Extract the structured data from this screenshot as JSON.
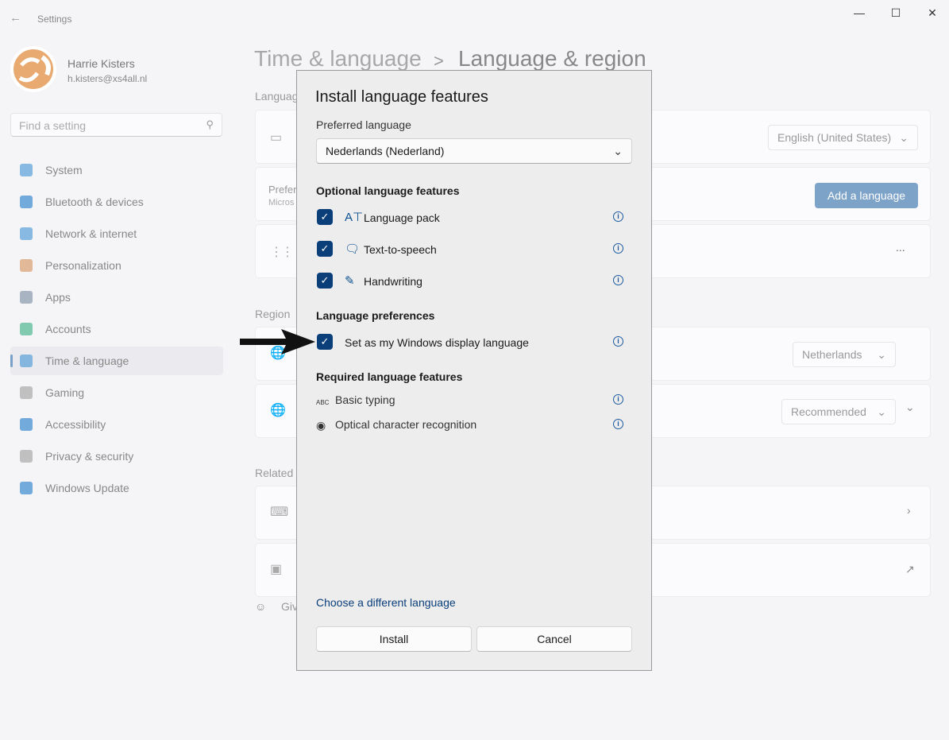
{
  "window": {
    "title": "Settings",
    "icons": [
      "back-arrow-icon",
      "minimize-icon",
      "maximize-icon",
      "close-icon"
    ]
  },
  "user": {
    "name": "Harrie Kisters",
    "email": "h.kisters@xs4all.nl"
  },
  "search": {
    "placeholder": "Find a setting"
  },
  "sidebar": {
    "items": [
      {
        "label": "System",
        "color": "#5aa0d8"
      },
      {
        "label": "Bluetooth & devices",
        "color": "#3a8ad0"
      },
      {
        "label": "Network & internet",
        "color": "#5aa0d8"
      },
      {
        "label": "Personalization",
        "color": "#d8a070"
      },
      {
        "label": "Apps",
        "color": "#8899aa"
      },
      {
        "label": "Accounts",
        "color": "#50b890"
      },
      {
        "label": "Time & language",
        "color": "#5aa0d8",
        "selected": true
      },
      {
        "label": "Gaming",
        "color": "#aaa"
      },
      {
        "label": "Accessibility",
        "color": "#3a8ad0"
      },
      {
        "label": "Privacy & security",
        "color": "#aaa"
      },
      {
        "label": "Windows Update",
        "color": "#3a8ad0"
      }
    ]
  },
  "breadcrumb": {
    "parent": "Time & language",
    "separator": ">",
    "current": "Language & region"
  },
  "background": {
    "section_language": "Languag",
    "display_language_value": "English (United States)",
    "preferred_title": "Prefer",
    "preferred_sub": "Micros",
    "add_language": "Add a language",
    "more": "...",
    "section_region": "Region",
    "country_value": "Netherlands",
    "format_value": "Recommended",
    "section_related": "Related",
    "feedback": "Giv"
  },
  "dialog": {
    "title": "Install language features",
    "preferred_label": "Preferred language",
    "preferred_value": "Nederlands (Nederland)",
    "optional_heading": "Optional language features",
    "optional": [
      {
        "label": "Language pack",
        "checked": true,
        "icon": "language-pack-icon"
      },
      {
        "label": "Text-to-speech",
        "checked": true,
        "icon": "text-to-speech-icon"
      },
      {
        "label": "Handwriting",
        "checked": true,
        "icon": "handwriting-icon"
      }
    ],
    "prefs_heading": "Language preferences",
    "display_lang": {
      "label": "Set as my Windows display language",
      "checked": true
    },
    "required_heading": "Required language features",
    "required": [
      {
        "label": "Basic typing",
        "icon": "abc-check-icon"
      },
      {
        "label": "Optical character recognition",
        "icon": "ocr-camera-icon"
      }
    ],
    "info_glyph": "i",
    "choose_link": "Choose a different language",
    "install": "Install",
    "cancel": "Cancel",
    "accent": "#0a3f7a"
  }
}
